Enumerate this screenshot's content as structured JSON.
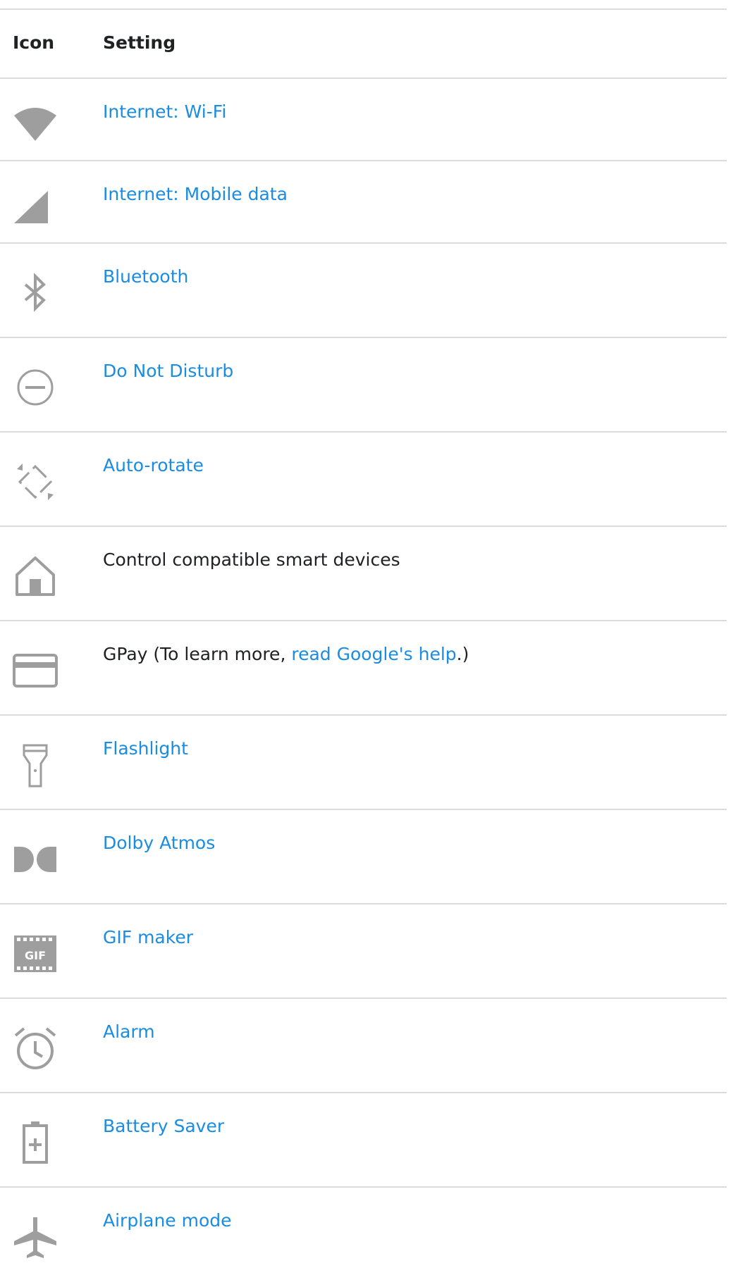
{
  "header": {
    "icon_col": "Icon",
    "setting_col": "Setting"
  },
  "rows": [
    {
      "icon": "wifi-icon",
      "label": "Internet: Wi-Fi",
      "link": true
    },
    {
      "icon": "mobile-data-icon",
      "label": "Internet: Mobile data",
      "link": true
    },
    {
      "icon": "bluetooth-icon",
      "label": "Bluetooth",
      "link": true
    },
    {
      "icon": "do-not-disturb-icon",
      "label": "Do Not Disturb",
      "link": true
    },
    {
      "icon": "auto-rotate-icon",
      "label": "Auto-rotate",
      "link": true
    },
    {
      "icon": "home-icon",
      "label": "Control compatible smart devices",
      "link": false
    },
    {
      "icon": "card-icon",
      "label_prefix": "GPay (To learn more, ",
      "label_link": "read Google's help",
      "label_suffix": ".)",
      "link": false
    },
    {
      "icon": "flashlight-icon",
      "label": "Flashlight",
      "link": true
    },
    {
      "icon": "dolby-icon",
      "label": "Dolby Atmos",
      "link": true
    },
    {
      "icon": "gif-icon",
      "icon_text": "GIF",
      "label": "GIF maker",
      "link": true
    },
    {
      "icon": "alarm-icon",
      "label": "Alarm",
      "link": true
    },
    {
      "icon": "battery-saver-icon",
      "label": "Battery Saver",
      "link": true
    },
    {
      "icon": "airplane-icon",
      "label": "Airplane mode",
      "link": true
    }
  ],
  "colors": {
    "link": "#1a8ce3",
    "icon_gray": "#9e9e9e",
    "divider": "#dadce0"
  }
}
